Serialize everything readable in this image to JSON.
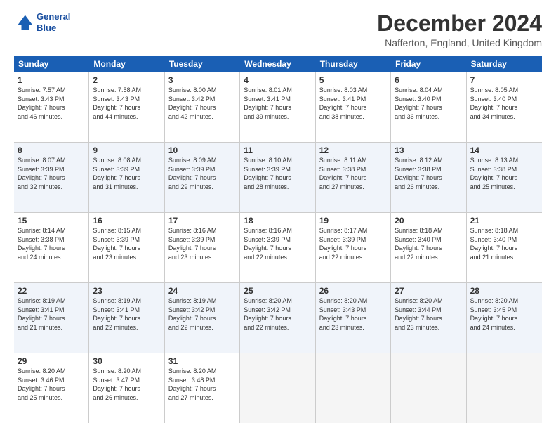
{
  "logo": {
    "line1": "General",
    "line2": "Blue"
  },
  "title": "December 2024",
  "location": "Nafferton, England, United Kingdom",
  "days_of_week": [
    "Sunday",
    "Monday",
    "Tuesday",
    "Wednesday",
    "Thursday",
    "Friday",
    "Saturday"
  ],
  "weeks": [
    {
      "alt": false,
      "cells": [
        {
          "day": "1",
          "info": "Sunrise: 7:57 AM\nSunset: 3:43 PM\nDaylight: 7 hours\nand 46 minutes."
        },
        {
          "day": "2",
          "info": "Sunrise: 7:58 AM\nSunset: 3:43 PM\nDaylight: 7 hours\nand 44 minutes."
        },
        {
          "day": "3",
          "info": "Sunrise: 8:00 AM\nSunset: 3:42 PM\nDaylight: 7 hours\nand 42 minutes."
        },
        {
          "day": "4",
          "info": "Sunrise: 8:01 AM\nSunset: 3:41 PM\nDaylight: 7 hours\nand 39 minutes."
        },
        {
          "day": "5",
          "info": "Sunrise: 8:03 AM\nSunset: 3:41 PM\nDaylight: 7 hours\nand 38 minutes."
        },
        {
          "day": "6",
          "info": "Sunrise: 8:04 AM\nSunset: 3:40 PM\nDaylight: 7 hours\nand 36 minutes."
        },
        {
          "day": "7",
          "info": "Sunrise: 8:05 AM\nSunset: 3:40 PM\nDaylight: 7 hours\nand 34 minutes."
        }
      ]
    },
    {
      "alt": true,
      "cells": [
        {
          "day": "8",
          "info": "Sunrise: 8:07 AM\nSunset: 3:39 PM\nDaylight: 7 hours\nand 32 minutes."
        },
        {
          "day": "9",
          "info": "Sunrise: 8:08 AM\nSunset: 3:39 PM\nDaylight: 7 hours\nand 31 minutes."
        },
        {
          "day": "10",
          "info": "Sunrise: 8:09 AM\nSunset: 3:39 PM\nDaylight: 7 hours\nand 29 minutes."
        },
        {
          "day": "11",
          "info": "Sunrise: 8:10 AM\nSunset: 3:39 PM\nDaylight: 7 hours\nand 28 minutes."
        },
        {
          "day": "12",
          "info": "Sunrise: 8:11 AM\nSunset: 3:38 PM\nDaylight: 7 hours\nand 27 minutes."
        },
        {
          "day": "13",
          "info": "Sunrise: 8:12 AM\nSunset: 3:38 PM\nDaylight: 7 hours\nand 26 minutes."
        },
        {
          "day": "14",
          "info": "Sunrise: 8:13 AM\nSunset: 3:38 PM\nDaylight: 7 hours\nand 25 minutes."
        }
      ]
    },
    {
      "alt": false,
      "cells": [
        {
          "day": "15",
          "info": "Sunrise: 8:14 AM\nSunset: 3:38 PM\nDaylight: 7 hours\nand 24 minutes."
        },
        {
          "day": "16",
          "info": "Sunrise: 8:15 AM\nSunset: 3:39 PM\nDaylight: 7 hours\nand 23 minutes."
        },
        {
          "day": "17",
          "info": "Sunrise: 8:16 AM\nSunset: 3:39 PM\nDaylight: 7 hours\nand 23 minutes."
        },
        {
          "day": "18",
          "info": "Sunrise: 8:16 AM\nSunset: 3:39 PM\nDaylight: 7 hours\nand 22 minutes."
        },
        {
          "day": "19",
          "info": "Sunrise: 8:17 AM\nSunset: 3:39 PM\nDaylight: 7 hours\nand 22 minutes."
        },
        {
          "day": "20",
          "info": "Sunrise: 8:18 AM\nSunset: 3:40 PM\nDaylight: 7 hours\nand 22 minutes."
        },
        {
          "day": "21",
          "info": "Sunrise: 8:18 AM\nSunset: 3:40 PM\nDaylight: 7 hours\nand 21 minutes."
        }
      ]
    },
    {
      "alt": true,
      "cells": [
        {
          "day": "22",
          "info": "Sunrise: 8:19 AM\nSunset: 3:41 PM\nDaylight: 7 hours\nand 21 minutes."
        },
        {
          "day": "23",
          "info": "Sunrise: 8:19 AM\nSunset: 3:41 PM\nDaylight: 7 hours\nand 22 minutes."
        },
        {
          "day": "24",
          "info": "Sunrise: 8:19 AM\nSunset: 3:42 PM\nDaylight: 7 hours\nand 22 minutes."
        },
        {
          "day": "25",
          "info": "Sunrise: 8:20 AM\nSunset: 3:42 PM\nDaylight: 7 hours\nand 22 minutes."
        },
        {
          "day": "26",
          "info": "Sunrise: 8:20 AM\nSunset: 3:43 PM\nDaylight: 7 hours\nand 23 minutes."
        },
        {
          "day": "27",
          "info": "Sunrise: 8:20 AM\nSunset: 3:44 PM\nDaylight: 7 hours\nand 23 minutes."
        },
        {
          "day": "28",
          "info": "Sunrise: 8:20 AM\nSunset: 3:45 PM\nDaylight: 7 hours\nand 24 minutes."
        }
      ]
    },
    {
      "alt": false,
      "cells": [
        {
          "day": "29",
          "info": "Sunrise: 8:20 AM\nSunset: 3:46 PM\nDaylight: 7 hours\nand 25 minutes."
        },
        {
          "day": "30",
          "info": "Sunrise: 8:20 AM\nSunset: 3:47 PM\nDaylight: 7 hours\nand 26 minutes."
        },
        {
          "day": "31",
          "info": "Sunrise: 8:20 AM\nSunset: 3:48 PM\nDaylight: 7 hours\nand 27 minutes."
        },
        {
          "day": "",
          "info": ""
        },
        {
          "day": "",
          "info": ""
        },
        {
          "day": "",
          "info": ""
        },
        {
          "day": "",
          "info": ""
        }
      ]
    }
  ]
}
